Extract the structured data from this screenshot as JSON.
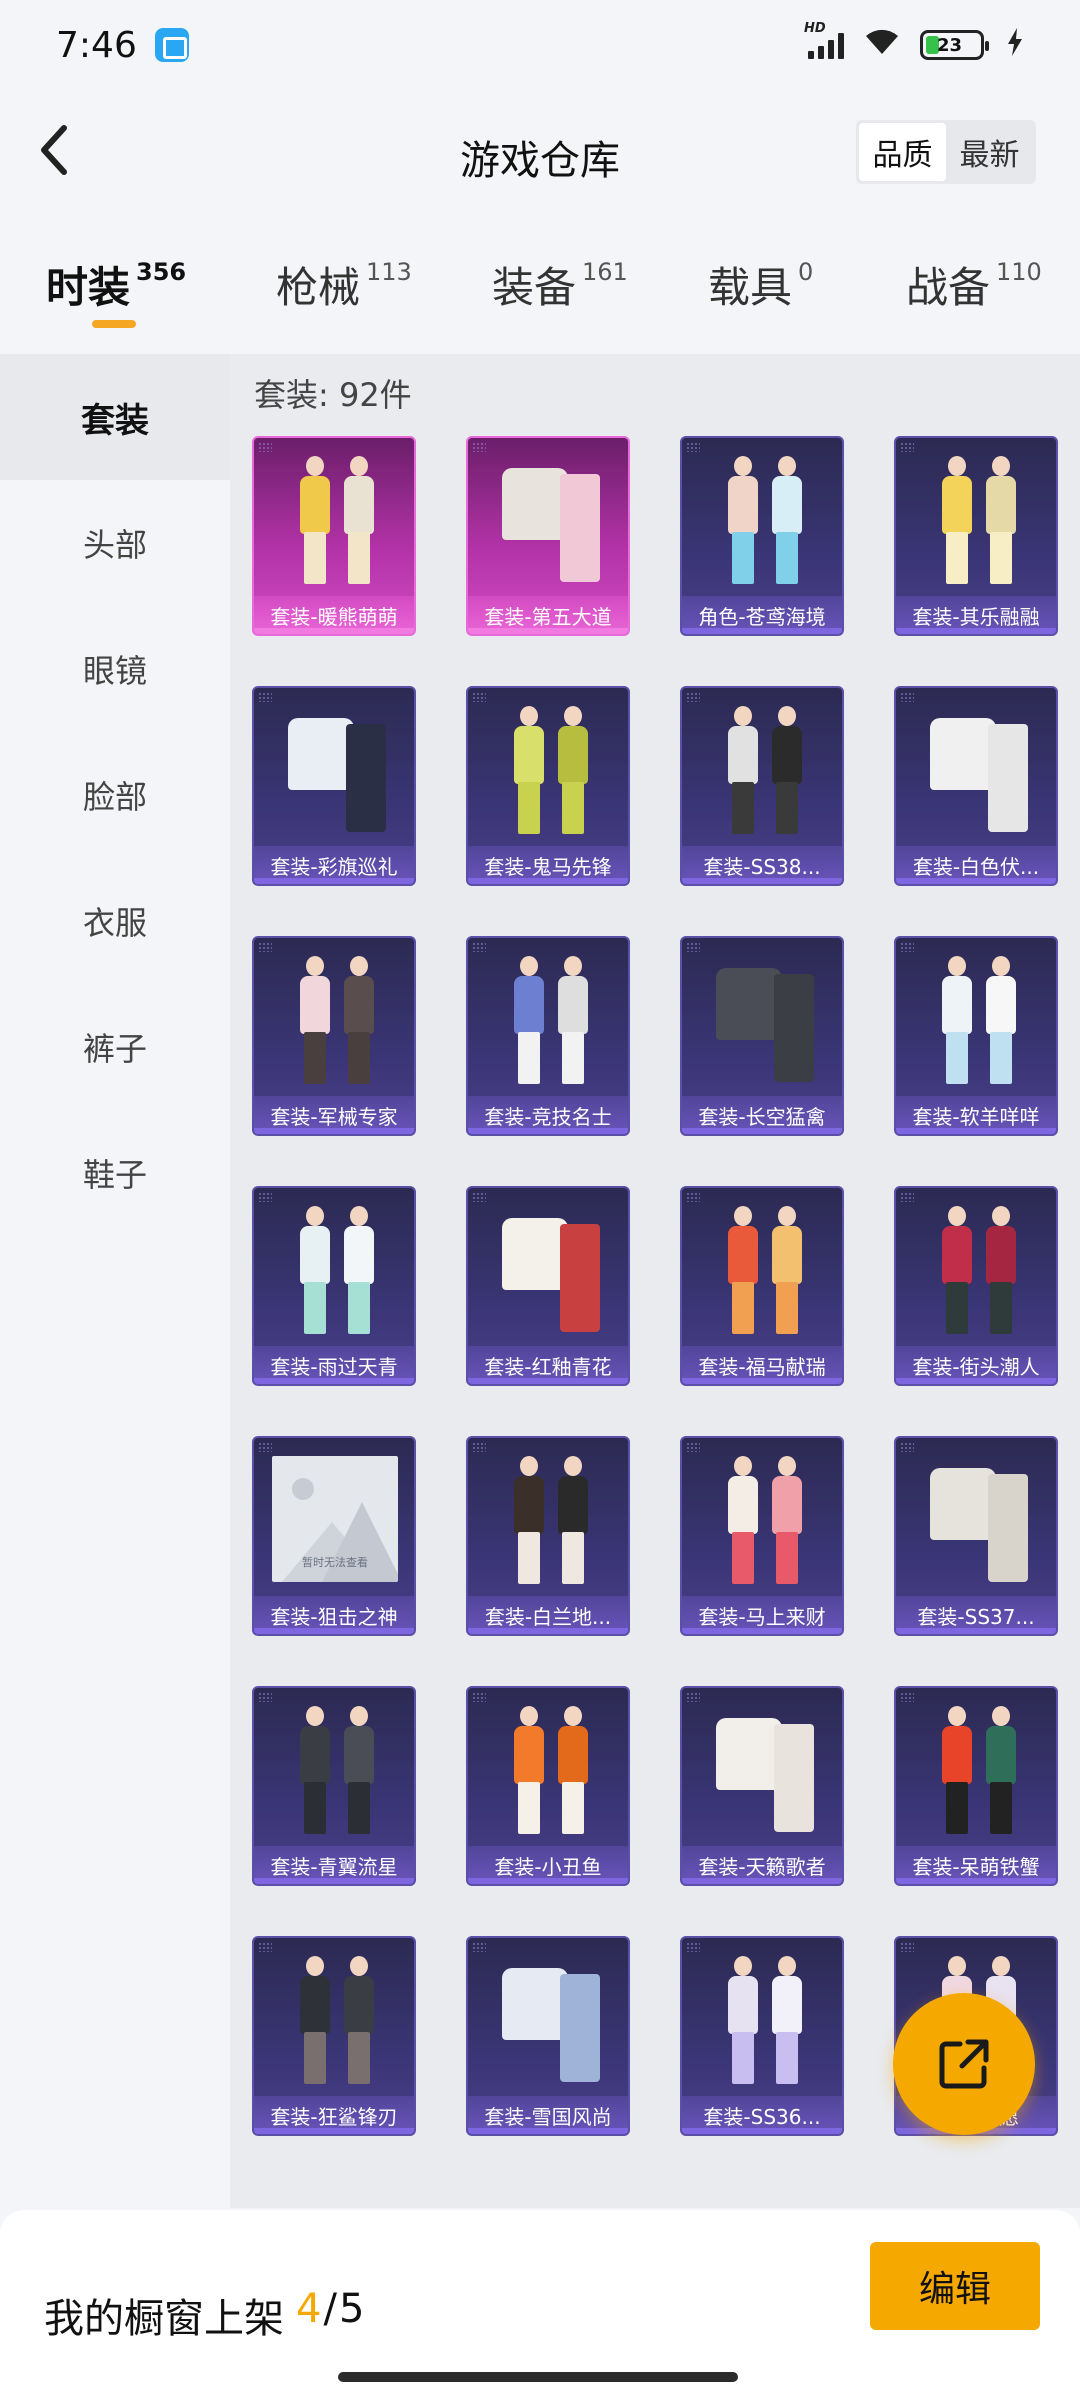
{
  "status_bar": {
    "time": "7:46",
    "network": "HD",
    "battery_level": "23",
    "icons": [
      "app-icon",
      "signal-icon",
      "wifi-icon",
      "battery-icon",
      "charging-icon"
    ]
  },
  "header": {
    "title": "游戏仓库",
    "sort_options": [
      "品质",
      "最新"
    ],
    "sort_active": "品质"
  },
  "categories": [
    {
      "label": "时装",
      "count": "356",
      "active": true
    },
    {
      "label": "枪械",
      "count": "113",
      "active": false
    },
    {
      "label": "装备",
      "count": "161",
      "active": false
    },
    {
      "label": "载具",
      "count": "0",
      "active": false
    },
    {
      "label": "战备",
      "count": "110",
      "active": false
    }
  ],
  "sidebar": {
    "items": [
      "套装",
      "头部",
      "眼镜",
      "脸部",
      "衣服",
      "裤子",
      "鞋子"
    ],
    "active": "套装"
  },
  "content": {
    "count_text": "套装: 92件",
    "items": [
      {
        "label": "套装-暖熊萌萌",
        "rarity": "legend"
      },
      {
        "label": "套装-第五大道",
        "rarity": "legend"
      },
      {
        "label": "角色-苍鸢海境",
        "rarity": "epic"
      },
      {
        "label": "套装-其乐融融",
        "rarity": "epic"
      },
      {
        "label": "套装-彩旗巡礼",
        "rarity": "epic"
      },
      {
        "label": "套装-鬼马先锋",
        "rarity": "epic"
      },
      {
        "label": "套装-SS38...",
        "rarity": "epic"
      },
      {
        "label": "套装-白色伏...",
        "rarity": "epic"
      },
      {
        "label": "套装-军械专家",
        "rarity": "epic"
      },
      {
        "label": "套装-竞技名士",
        "rarity": "epic"
      },
      {
        "label": "套装-长空猛禽",
        "rarity": "epic"
      },
      {
        "label": "套装-软羊咩咩",
        "rarity": "epic"
      },
      {
        "label": "套装-雨过天青",
        "rarity": "epic"
      },
      {
        "label": "套装-红釉青花",
        "rarity": "epic"
      },
      {
        "label": "套装-福马献瑞",
        "rarity": "epic"
      },
      {
        "label": "套装-街头潮人",
        "rarity": "epic"
      },
      {
        "label": "套装-狙击之神",
        "rarity": "epic",
        "placeholder": true,
        "placeholder_text": "暂时无法查看"
      },
      {
        "label": "套装-白兰地...",
        "rarity": "epic"
      },
      {
        "label": "套装-马上来财",
        "rarity": "epic"
      },
      {
        "label": "套装-SS37...",
        "rarity": "epic"
      },
      {
        "label": "套装-青翼流星",
        "rarity": "epic"
      },
      {
        "label": "套装-小丑鱼",
        "rarity": "epic"
      },
      {
        "label": "套装-天籁歌者",
        "rarity": "epic"
      },
      {
        "label": "套装-呆萌铁蟹",
        "rarity": "epic"
      },
      {
        "label": "套装-狂鲨锋刃",
        "rarity": "epic"
      },
      {
        "label": "套装-雪国风尚",
        "rarity": "epic"
      },
      {
        "label": "套装-SS36...",
        "rarity": "epic"
      },
      {
        "label": "套装-...愿",
        "rarity": "epic"
      }
    ]
  },
  "fab": {
    "icon": "share-external-icon"
  },
  "bottom_bar": {
    "shelf_label": "我的橱窗上架",
    "shelf_current": "4",
    "shelf_sep": "/",
    "shelf_total": "5",
    "edit_label": "编辑"
  },
  "colors": {
    "accent": "#f5a800",
    "legend_card": "#c23bb5",
    "epic_card": "#3a3575"
  }
}
